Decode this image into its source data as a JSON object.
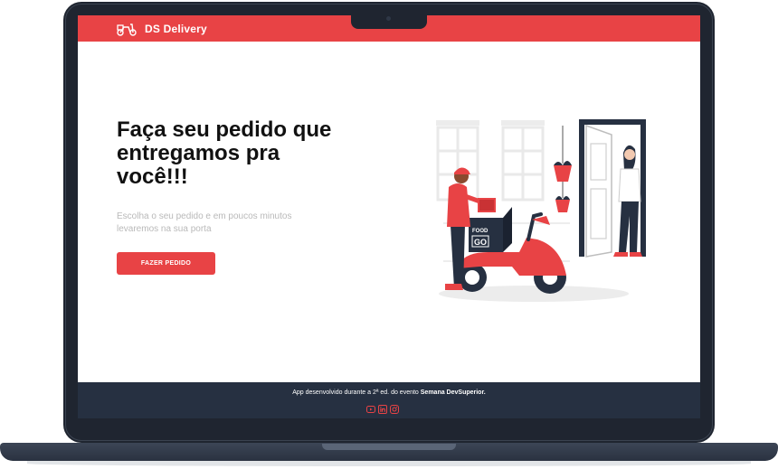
{
  "app": {
    "title": "DS Delivery"
  },
  "hero": {
    "title": "Faça seu pedido que entregamos pra você!!!",
    "subtitle": "Escolha o seu pedido e em poucos minutos levaremos na sua porta",
    "cta_label": "FAZER PEDIDO"
  },
  "illustration": {
    "box_text_top": "FOOD",
    "box_text_bottom": "GO"
  },
  "footer": {
    "text_prefix": "App desenvolvido durante a 2ª ed. do evento ",
    "text_bold": "Semana DevSuperior.",
    "social_icons": [
      "youtube-icon",
      "linkedin-icon",
      "instagram-icon"
    ]
  },
  "colors": {
    "brand": "#e84345",
    "footer_bg": "#263041",
    "laptop": "#1f2530"
  }
}
